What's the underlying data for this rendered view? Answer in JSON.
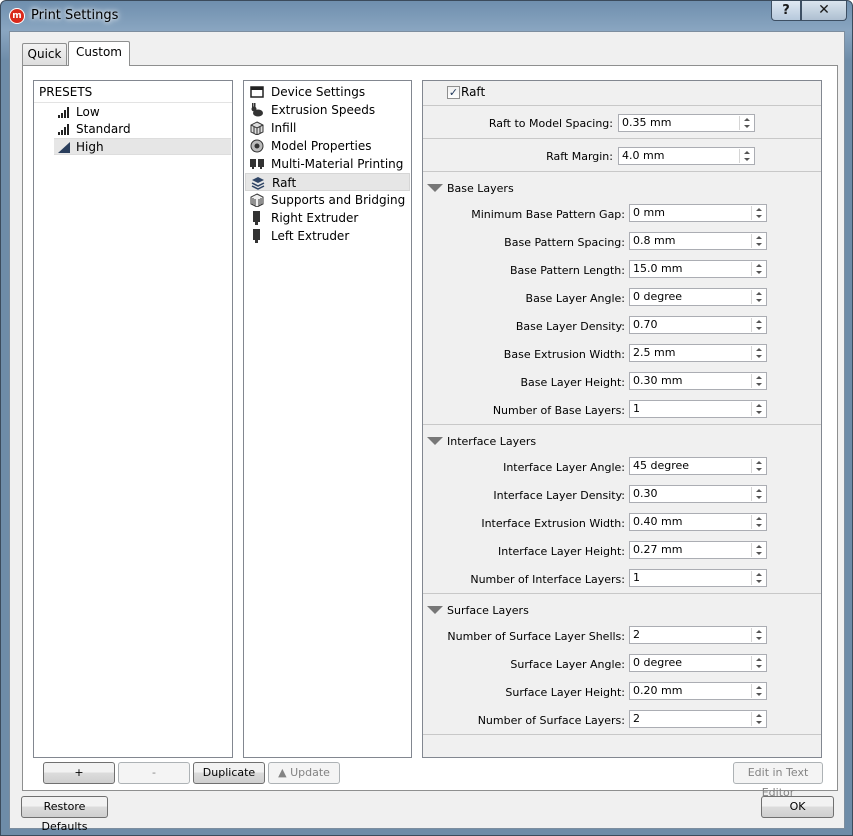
{
  "window": {
    "title": "Print Settings",
    "help_label": "?",
    "close_label": "✕",
    "app_icon": "makerbot-logo"
  },
  "tabs": [
    {
      "label": "Quick"
    },
    {
      "label": "Custom"
    }
  ],
  "presets": {
    "header": "PRESETS",
    "items": [
      {
        "label": "Low",
        "icon": "signal-bars-icon"
      },
      {
        "label": "Standard",
        "icon": "signal-bars-icon"
      },
      {
        "label": "High",
        "icon": "signal-triangle-icon",
        "selected": true
      }
    ]
  },
  "categories": [
    {
      "label": "Device Settings",
      "icon": "window-icon"
    },
    {
      "label": "Extrusion Speeds",
      "icon": "rabbit-icon"
    },
    {
      "label": "Infill",
      "icon": "cube-grid-icon"
    },
    {
      "label": "Model Properties",
      "icon": "disc-icon"
    },
    {
      "label": "Multi-Material Printing",
      "icon": "dual-extruder-icon"
    },
    {
      "label": "Raft",
      "icon": "layers-icon",
      "selected": true
    },
    {
      "label": "Supports and Bridging",
      "icon": "support-cube-icon"
    },
    {
      "label": "Right Extruder",
      "icon": "extruder-icon"
    },
    {
      "label": "Left Extruder",
      "icon": "extruder-icon"
    }
  ],
  "raft": {
    "enabled_label": "Raft",
    "enabled": true,
    "spacing": {
      "label": "Raft to Model Spacing:",
      "value": "0.35 mm"
    },
    "margin": {
      "label": "Raft Margin:",
      "value": "4.0 mm"
    },
    "base_layers": {
      "title": "Base Layers",
      "fields": [
        {
          "label": "Minimum Base Pattern Gap:",
          "value": "0 mm"
        },
        {
          "label": "Base Pattern Spacing:",
          "value": "0.8 mm"
        },
        {
          "label": "Base Pattern Length:",
          "value": "15.0 mm"
        },
        {
          "label": "Base Layer Angle:",
          "value": "0 degree"
        },
        {
          "label": "Base Layer Density:",
          "value": "0.70"
        },
        {
          "label": "Base Extrusion Width:",
          "value": "2.5 mm"
        },
        {
          "label": "Base Layer Height:",
          "value": "0.30 mm"
        },
        {
          "label": "Number of Base Layers:",
          "value": "1"
        }
      ]
    },
    "interface_layers": {
      "title": "Interface Layers",
      "fields": [
        {
          "label": "Interface Layer Angle:",
          "value": "45 degree"
        },
        {
          "label": "Interface Layer Density:",
          "value": "0.30"
        },
        {
          "label": "Interface Extrusion Width:",
          "value": "0.40 mm"
        },
        {
          "label": "Interface Layer Height:",
          "value": "0.27 mm"
        },
        {
          "label": "Number of Interface Layers:",
          "value": "1"
        }
      ]
    },
    "surface_layers": {
      "title": "Surface Layers",
      "fields": [
        {
          "label": "Number of Surface Layer Shells:",
          "value": "2"
        },
        {
          "label": "Surface Layer Angle:",
          "value": "0 degree"
        },
        {
          "label": "Surface Layer Height:",
          "value": "0.20 mm"
        },
        {
          "label": "Number of Surface Layers:",
          "value": "2"
        }
      ]
    }
  },
  "buttons": {
    "add": "+",
    "remove": "-",
    "duplicate": "Duplicate",
    "update": "Update",
    "edit_text": "Edit in Text Editor",
    "restore": "Restore Defaults",
    "ok": "OK"
  }
}
